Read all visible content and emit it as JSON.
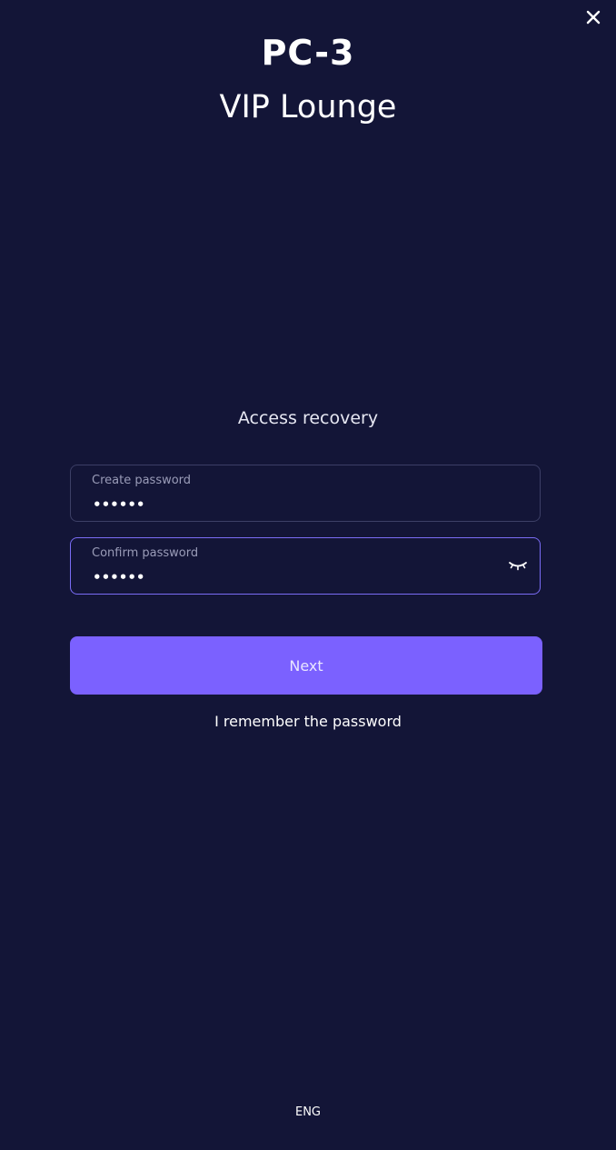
{
  "header": {
    "title": "PC-3",
    "subtitle": "VIP Lounge"
  },
  "close_button": {
    "icon": "close-icon"
  },
  "form": {
    "heading": "Access recovery",
    "create_password": {
      "label": "Create password",
      "value": "••••••"
    },
    "confirm_password": {
      "label": "Confirm password",
      "value": "••••••",
      "toggle_icon": "eye-closed-icon"
    },
    "next_label": "Next",
    "remember_link": "I remember the password"
  },
  "footer": {
    "language": "ENG"
  },
  "colors": {
    "background": "#131537",
    "accent": "#7b61ff",
    "field_border": "#3c3f66",
    "field_border_active": "#7a6cf5"
  }
}
